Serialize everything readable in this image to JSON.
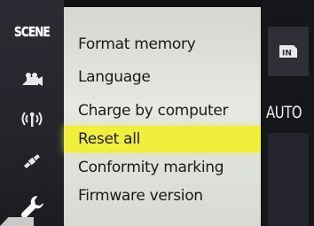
{
  "rail": {
    "items": [
      {
        "name": "scene-icon",
        "text": "SCENE"
      },
      {
        "name": "movie-icon"
      },
      {
        "name": "wireless-icon"
      },
      {
        "name": "satellite-icon"
      },
      {
        "name": "wrench-icon"
      }
    ]
  },
  "menu": {
    "items": [
      {
        "label": "Format memory"
      },
      {
        "label": "Language"
      },
      {
        "label": "Charge by computer"
      },
      {
        "label": "Reset all",
        "selected": true
      },
      {
        "label": "Conformity marking"
      },
      {
        "label": "Firmware version"
      }
    ]
  },
  "status": {
    "mode_text": "AUTO",
    "storage_icon": "internal-memory-icon",
    "storage_text": "IN"
  },
  "colors": {
    "highlight": "#f0f03c",
    "menu_bg": "#e2e4de",
    "rail_bg": "#2b2c33"
  }
}
